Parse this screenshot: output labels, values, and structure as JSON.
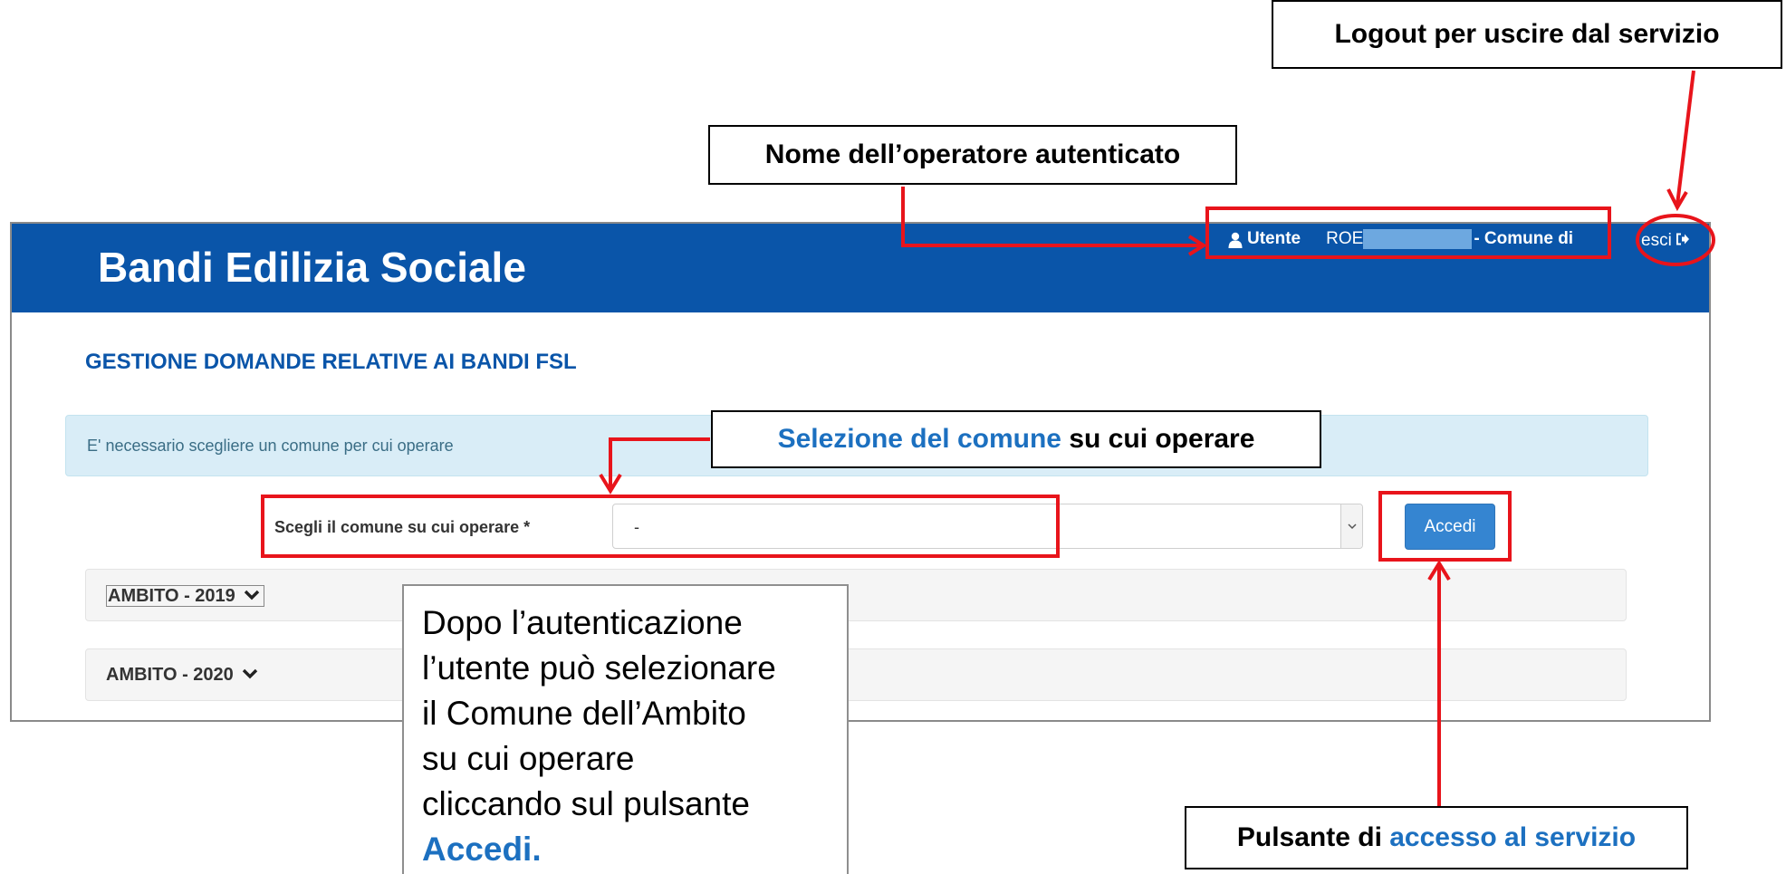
{
  "app": {
    "title": "Bandi Edilizia Sociale",
    "user_label": "Utente",
    "user_name": "ROE",
    "comune_label": "- Comune di",
    "logout_label": "esci"
  },
  "main": {
    "heading": "GESTIONE DOMANDE RELATIVE AI BANDI FSL",
    "info_message": "E' necessario scegliere un comune per cui operare",
    "comune_field_label": "Scegli il comune su cui operare *",
    "comune_selected_value": "-",
    "accedi_button": "Accedi",
    "ambiti": [
      {
        "label": "AMBITO - 2019"
      },
      {
        "label": "AMBITO - 2020"
      }
    ]
  },
  "annotations": {
    "logout": "Logout per uscire dal servizio",
    "operatore": "Nome dell’operatore autenticato",
    "selezione_part1": "Selezione del comune",
    "selezione_part2": " su cui operare",
    "pulsante_part1": "Pulsante di ",
    "pulsante_part2": "accesso al servizio",
    "description_lines": [
      "Dopo l’autenticazione",
      "l’utente può selezionare",
      "il Comune dell’Ambito",
      "su cui operare",
      "cliccando sul pulsante"
    ],
    "description_accedi": "Accedi."
  },
  "colors": {
    "header_blue": "#0a55a9",
    "annotation_red": "#e8141b",
    "annotation_blue": "#1c70c0",
    "button_blue": "#3585d1",
    "alert_bg": "#d9edf7"
  },
  "icons": {
    "user": "user-icon",
    "logout": "sign-out-icon",
    "select": "chevron-down-icon",
    "accordion": "chevron-down-icon"
  }
}
